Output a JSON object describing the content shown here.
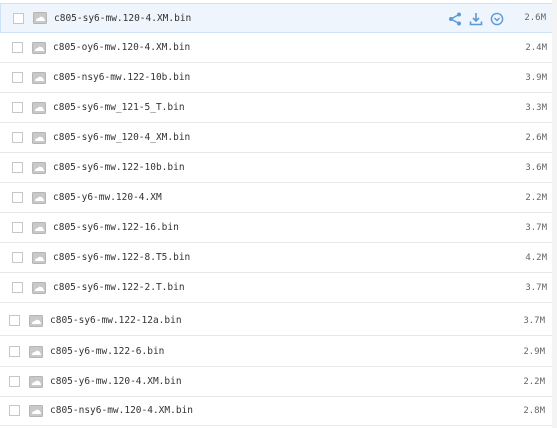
{
  "files": [
    {
      "name": "c805-sy6-mw.120-4.XM.bin",
      "size": "2.6M"
    },
    {
      "name": "c805-oy6-mw.120-4.XM.bin",
      "size": "2.4M"
    },
    {
      "name": "c805-nsy6-mw.122-10b.bin",
      "size": "3.9M"
    },
    {
      "name": "c805-sy6-mw_121-5_T.bin",
      "size": "3.3M"
    },
    {
      "name": "c805-sy6-mw_120-4_XM.bin",
      "size": "2.6M"
    },
    {
      "name": "c805-sy6-mw.122-10b.bin",
      "size": "3.6M"
    },
    {
      "name": "c805-y6-mw.120-4.XM",
      "size": "2.2M"
    },
    {
      "name": "c805-sy6-mw.122-16.bin",
      "size": "3.7M"
    },
    {
      "name": "c805-sy6-mw.122-8.T5.bin",
      "size": "4.2M"
    },
    {
      "name": "c805-sy6-mw.122-2.T.bin",
      "size": "3.7M"
    },
    {
      "name": "c805-sy6-mw.122-12a.bin",
      "size": "3.7M"
    },
    {
      "name": "c805-y6-mw.122-6.bin",
      "size": "2.9M"
    },
    {
      "name": "c805-y6-mw.120-4.XM.bin",
      "size": "2.2M"
    },
    {
      "name": "c805-nsy6-mw.120-4.XM.bin",
      "size": "2.8M"
    }
  ],
  "row_actions": [
    "share-icon",
    "download-icon",
    "more-icon"
  ],
  "colors": {
    "accent": "#5b9bd5",
    "hover_bg": "#eef5fd",
    "divider": "#e8e8e8"
  }
}
